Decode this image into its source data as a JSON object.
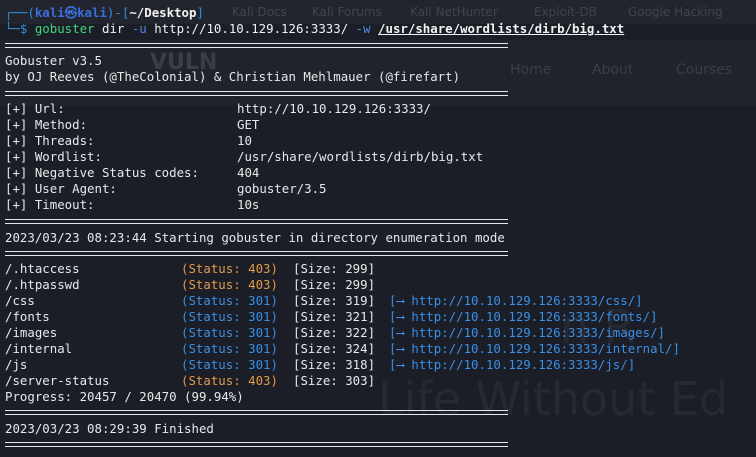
{
  "background": {
    "bookmarks": [
      "Kali Docs",
      "Kali Forums",
      "Kali NetHunter",
      "Exploit-DB",
      "Google Hacking"
    ],
    "logo": "VULN",
    "nav": [
      "Home",
      "About",
      "Courses"
    ],
    "hero": "Life Without Ed"
  },
  "prompt": {
    "open": "┌──(",
    "user": "kali",
    "at": "㉿",
    "host": "kali",
    "mid": ")-[",
    "path": "~/Desktop",
    "close": "]",
    "second": "└─$ "
  },
  "command": {
    "name": "gobuster",
    "sub": " dir ",
    "flag_u": "-u",
    "url": " http://10.10.129.126:3333/ ",
    "flag_w": "-w",
    "wordlist": "/usr/share/wordlists/dirb/big.txt"
  },
  "banner": {
    "version": "Gobuster v3.5",
    "authors": "by OJ Reeves (@TheColonial) & Christian Mehlmauer (@firefart)"
  },
  "config": [
    {
      "key": "[+] Url:",
      "value": "http://10.10.129.126:3333/"
    },
    {
      "key": "[+] Method:",
      "value": "GET"
    },
    {
      "key": "[+] Threads:",
      "value": "10"
    },
    {
      "key": "[+] Wordlist:",
      "value": "/usr/share/wordlists/dirb/big.txt"
    },
    {
      "key": "[+] Negative Status codes:",
      "value": "404"
    },
    {
      "key": "[+] User Agent:",
      "value": "gobuster/3.5"
    },
    {
      "key": "[+] Timeout:",
      "value": "10s"
    }
  ],
  "start_line": "2023/03/23 08:23:44 Starting gobuster in directory enumeration mode",
  "results": [
    {
      "path": "/.htaccess",
      "status": "(Status: 403)",
      "code": 403,
      "size": "[Size: 299]",
      "redirect": ""
    },
    {
      "path": "/.htpasswd",
      "status": "(Status: 403)",
      "code": 403,
      "size": "[Size: 299]",
      "redirect": ""
    },
    {
      "path": "/css",
      "status": "(Status: 301)",
      "code": 301,
      "size": "[Size: 319]",
      "redirect": "[⟶ http://10.10.129.126:3333/css/]"
    },
    {
      "path": "/fonts",
      "status": "(Status: 301)",
      "code": 301,
      "size": "[Size: 321]",
      "redirect": "[⟶ http://10.10.129.126:3333/fonts/]"
    },
    {
      "path": "/images",
      "status": "(Status: 301)",
      "code": 301,
      "size": "[Size: 322]",
      "redirect": "[⟶ http://10.10.129.126:3333/images/]"
    },
    {
      "path": "/internal",
      "status": "(Status: 301)",
      "code": 301,
      "size": "[Size: 324]",
      "redirect": "[⟶ http://10.10.129.126:3333/internal/]"
    },
    {
      "path": "/js",
      "status": "(Status: 301)",
      "code": 301,
      "size": "[Size: 318]",
      "redirect": "[⟶ http://10.10.129.126:3333/js/]"
    },
    {
      "path": "/server-status",
      "status": "(Status: 403)",
      "code": 403,
      "size": "[Size: 303]",
      "redirect": ""
    }
  ],
  "progress": "Progress: 20457 / 20470 (99.94%)",
  "finished_line": "2023/03/23 08:29:39 Finished",
  "colors": {
    "background": "#1b1e27",
    "command": "#3fd57a",
    "flag": "#4f88e8",
    "status_403": "#e49a4a",
    "status_301": "#3a8fe6"
  }
}
